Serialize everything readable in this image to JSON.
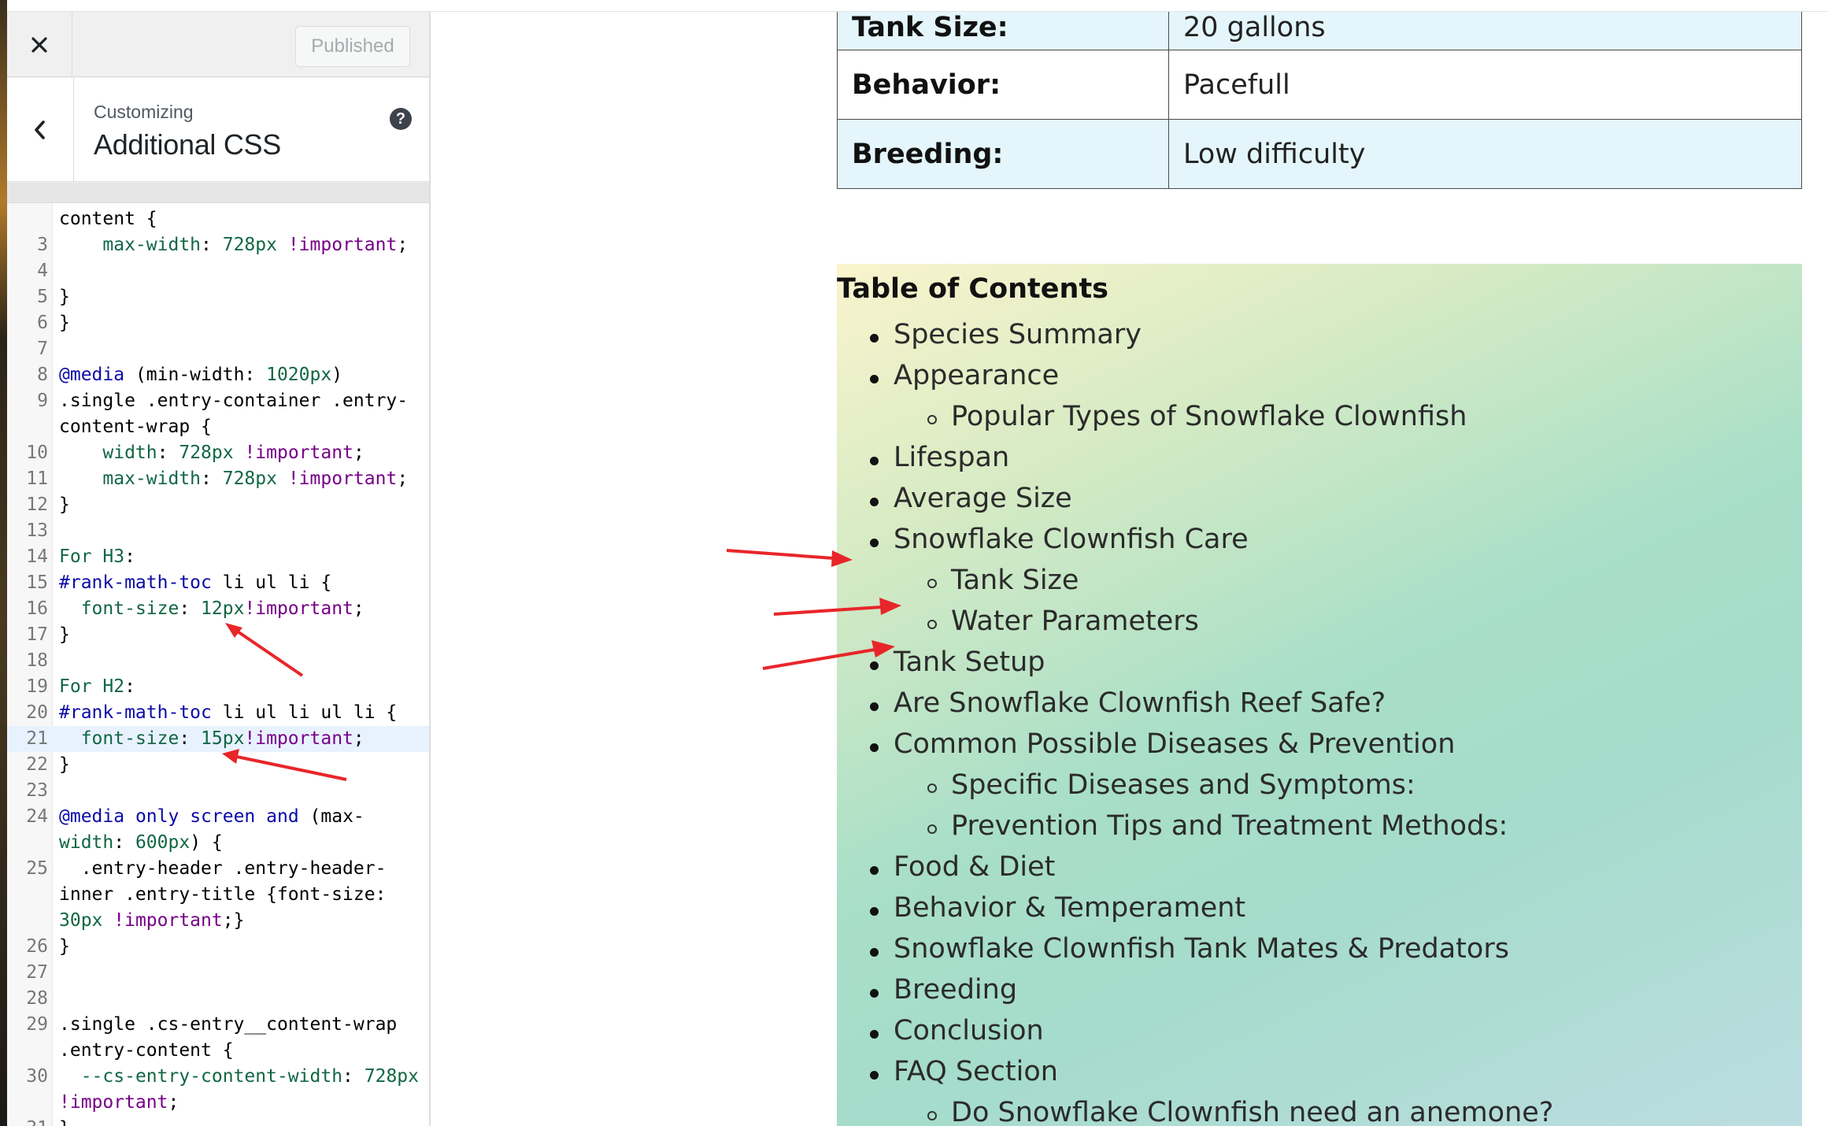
{
  "customizer": {
    "published_label": "Published",
    "customizing_label": "Customizing",
    "section_title": "Additional CSS",
    "close_icon": "close-icon",
    "back_icon": "chevron-left-icon",
    "help_icon": "help-icon",
    "help_glyph": "?"
  },
  "code_lines": [
    {
      "n": "",
      "t": "content {"
    },
    {
      "n": "3",
      "t": "    max-width: 728px !important;"
    },
    {
      "n": "4",
      "t": ""
    },
    {
      "n": "5",
      "t": "}"
    },
    {
      "n": "6",
      "t": "}"
    },
    {
      "n": "7",
      "t": ""
    },
    {
      "n": "8",
      "t": "@media (min-width: 1020px)"
    },
    {
      "n": "9",
      "t": ".single .entry-container .entry-"
    },
    {
      "n": "",
      "t": "content-wrap {"
    },
    {
      "n": "10",
      "t": "    width: 728px !important;"
    },
    {
      "n": "11",
      "t": "    max-width: 728px !important;"
    },
    {
      "n": "12",
      "t": "}"
    },
    {
      "n": "13",
      "t": ""
    },
    {
      "n": "14",
      "t": "For H3:"
    },
    {
      "n": "15",
      "t": "#rank-math-toc li ul li {"
    },
    {
      "n": "16",
      "t": "  font-size: 12px!important;"
    },
    {
      "n": "17",
      "t": "}"
    },
    {
      "n": "18",
      "t": ""
    },
    {
      "n": "19",
      "t": "For H2:"
    },
    {
      "n": "20",
      "t": "#rank-math-toc li ul li ul li {"
    },
    {
      "n": "21",
      "t": "  font-size: 15px!important;"
    },
    {
      "n": "22",
      "t": "}"
    },
    {
      "n": "23",
      "t": ""
    },
    {
      "n": "24",
      "t": "@media only screen and (max-"
    },
    {
      "n": "",
      "t": "width: 600px) {"
    },
    {
      "n": "25",
      "t": "  .entry-header .entry-header-"
    },
    {
      "n": "",
      "t": "inner .entry-title {font-size:"
    },
    {
      "n": "",
      "t": "30px !important;}"
    },
    {
      "n": "26",
      "t": "}"
    },
    {
      "n": "27",
      "t": ""
    },
    {
      "n": "28",
      "t": ""
    },
    {
      "n": "29",
      "t": ".single .cs-entry__content-wrap"
    },
    {
      "n": "",
      "t": ".entry-content {"
    },
    {
      "n": "30",
      "t": "  --cs-entry-content-width: 728px"
    },
    {
      "n": "",
      "t": "!important;"
    },
    {
      "n": "31",
      "t": "}"
    }
  ],
  "spec_table": [
    {
      "label": "Tank Size:",
      "value": "20 gallons"
    },
    {
      "label": "Behavior:",
      "value": "Pacefull"
    },
    {
      "label": "Breeding:",
      "value": "Low difficulty"
    }
  ],
  "toc": {
    "title": "Table of Contents",
    "items": [
      {
        "text": "Species Summary",
        "level": 1
      },
      {
        "text": "Appearance",
        "level": 1
      },
      {
        "text": "Popular Types of Snowflake Clownfish",
        "level": 2
      },
      {
        "text": "Lifespan",
        "level": 1
      },
      {
        "text": "Average Size",
        "level": 1
      },
      {
        "text": "Snowflake Clownfish Care",
        "level": 1
      },
      {
        "text": "Tank Size",
        "level": 2
      },
      {
        "text": "Water Parameters",
        "level": 2
      },
      {
        "text": "Tank Setup",
        "level": 1
      },
      {
        "text": "Are Snowflake Clownfish Reef Safe?",
        "level": 1
      },
      {
        "text": "Common Possible Diseases & Prevention",
        "level": 1
      },
      {
        "text": "Specific Diseases and Symptoms:",
        "level": 2
      },
      {
        "text": "Prevention Tips and Treatment Methods:",
        "level": 2
      },
      {
        "text": "Food & Diet",
        "level": 1
      },
      {
        "text": "Behavior & Temperament",
        "level": 1
      },
      {
        "text": "Snowflake Clownfish Tank Mates & Predators",
        "level": 1
      },
      {
        "text": "Breeding",
        "level": 1
      },
      {
        "text": "Conclusion",
        "level": 1
      },
      {
        "text": "FAQ Section",
        "level": 1
      },
      {
        "text": "Do Snowflake Clownfish need an anemone?",
        "level": 2
      }
    ]
  },
  "colors": {
    "annotation_arrow": "#e8262a",
    "toc_gradient_start": "#faf4cd",
    "toc_gradient_end": "#bcdde2",
    "table_tint": "#e4f6fb"
  }
}
